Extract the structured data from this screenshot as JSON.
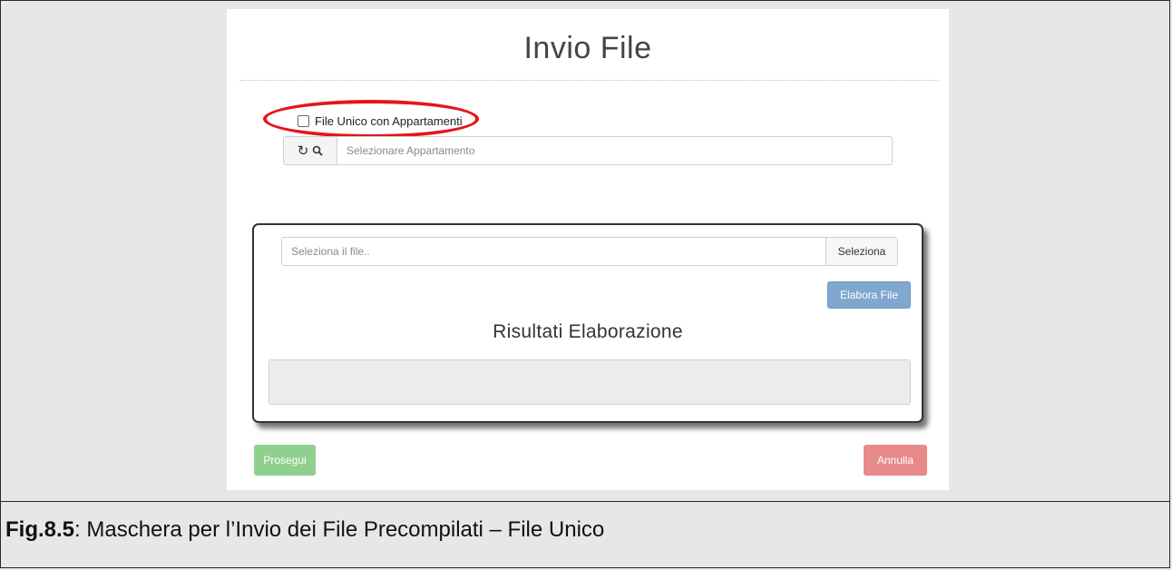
{
  "form": {
    "title": "Invio File",
    "checkbox_label": "File Unico con Appartamenti",
    "apartment_placeholder": "Selezionare Appartamento",
    "refresh_icon": "↻",
    "search_icon": "🔍"
  },
  "upload": {
    "file_placeholder": "Seleziona il file..",
    "select_button": "Seleziona",
    "process_button": "Elabora File",
    "results_title": "Risultati Elaborazione",
    "results_value": ""
  },
  "actions": {
    "proceed": "Prosegui",
    "cancel": "Annulla"
  },
  "caption": {
    "label": "Fig.8.5",
    "text": ": Maschera per l’Invio dei File Precompilati – File Unico"
  },
  "colors": {
    "highlight": "#e4161b",
    "process_button": "#7fa7cf",
    "proceed_button": "#8fd08f",
    "cancel_button": "#e88a8a"
  }
}
